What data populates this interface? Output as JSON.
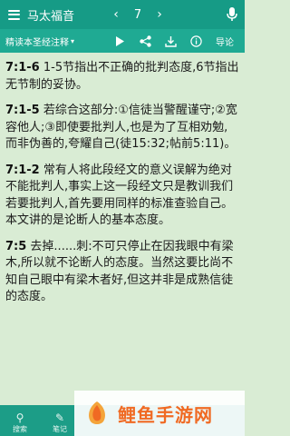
{
  "header": {
    "title": "马太福音",
    "prev_arrow": "‹",
    "chapter": "7",
    "next_arrow": "›",
    "menu_icon": "hamburger-icon",
    "mic_icon": "microphone-icon"
  },
  "toolbar": {
    "version_label": "精读本圣经注释",
    "version_caret": "▾",
    "notes_label": "导论",
    "icons": [
      "play-icon",
      "share-icon",
      "download-icon",
      "info-icon"
    ]
  },
  "content": {
    "paragraphs": [
      {
        "ref": "7:1-6",
        "text": " 1-5节指出不正确的批判态度,6节指出无节制的妥协。"
      },
      {
        "ref": "7:1-5",
        "text": " 若综合这部分:①信徒当警醒谨守;②宽容他人;③即使要批判人,也是为了互相劝勉,而非伪善的,夸耀自己(徒15:32;帖前5:11)。"
      },
      {
        "ref": "7:1-2",
        "text": " 常有人将此段经文的意义误解为绝对不能批判人,事实上这一段经文只是教训我们若要批判人,首先要用同样的标准查验自己。本文讲的是论断人的基本态度。"
      },
      {
        "ref": "7:5",
        "text": " 去掉......刺:不可只停止在因我眼中有梁木,所以就不论断人的态度。当然这要比尚不知自己眼中有梁木者好,但这并非是成熟信徒的态度。"
      }
    ]
  },
  "bottombar": {
    "tabs": [
      {
        "label": "搜索",
        "icon": "search-icon"
      },
      {
        "label": "笔记",
        "icon": "note-icon"
      }
    ]
  },
  "watermark": {
    "text": "鲤鱼手游网"
  }
}
